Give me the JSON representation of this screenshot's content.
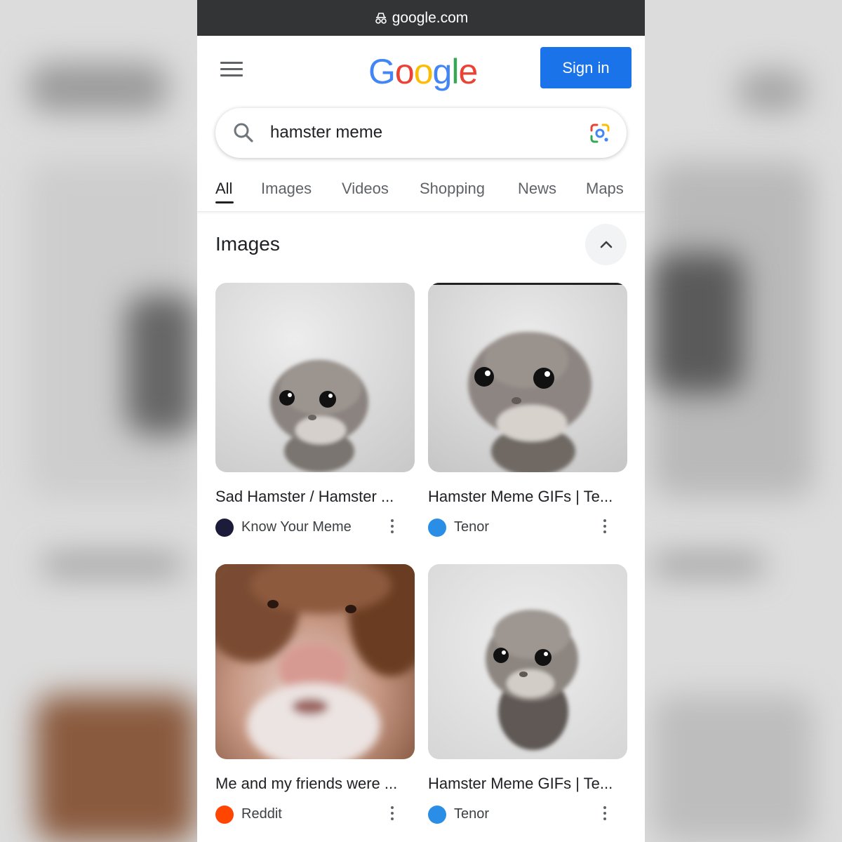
{
  "browser": {
    "url": "google.com"
  },
  "header": {
    "logo": [
      "G",
      "o",
      "o",
      "g",
      "l",
      "e"
    ],
    "logo_colors": [
      "#4285F4",
      "#EA4335",
      "#FBBC05",
      "#4285F4",
      "#34A853",
      "#EA4335"
    ],
    "sign_in_label": "Sign in"
  },
  "search": {
    "query": "hamster meme"
  },
  "tabs": [
    {
      "label": "All",
      "active": true
    },
    {
      "label": "Images"
    },
    {
      "label": "Videos"
    },
    {
      "label": "Shopping"
    },
    {
      "label": "News"
    },
    {
      "label": "Maps"
    }
  ],
  "images_section": {
    "title": "Images",
    "results": [
      {
        "title": "Sad Hamster / Hamster ...",
        "source": "Know Your Meme",
        "icon": "knowyourmeme-icon"
      },
      {
        "title": "Hamster Meme GIFs | Te...",
        "source": "Tenor",
        "icon": "tenor-icon"
      },
      {
        "title": "Me and my friends were ...",
        "source": "Reddit",
        "icon": "reddit-icon"
      },
      {
        "title": "Hamster Meme GIFs | Te...",
        "source": "Tenor",
        "icon": "tenor-icon"
      }
    ]
  },
  "colors": {
    "accent": "#1a73e8",
    "url_bar": "#333436"
  }
}
